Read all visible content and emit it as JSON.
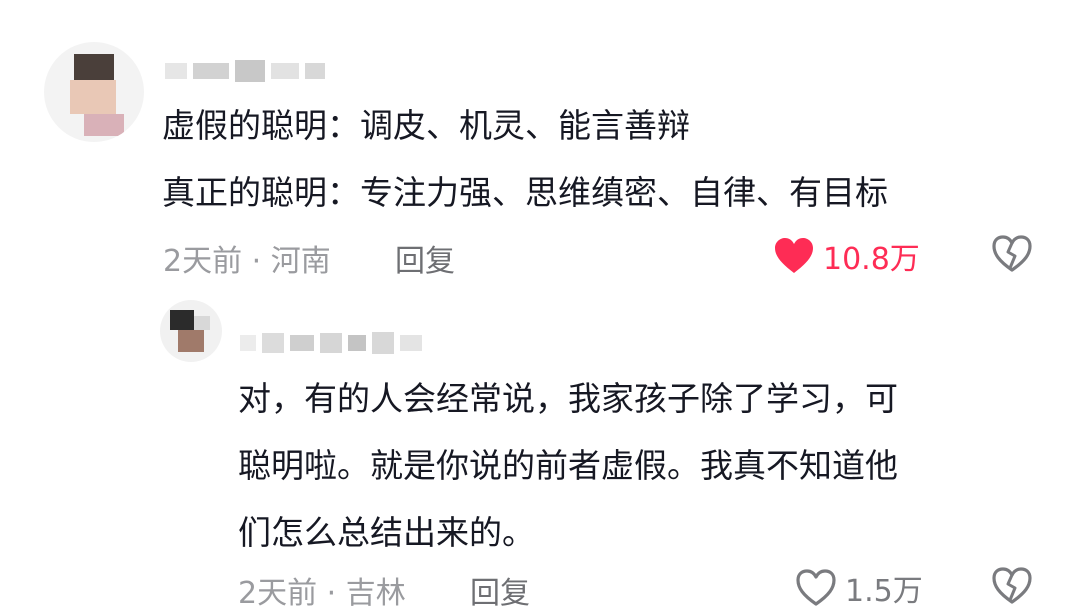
{
  "comment": {
    "text": "虚假的聪明：调皮、机灵、能言善辩\n真正的聪明：专注力强、思维缜密、自律、有目标",
    "time": "2天前",
    "location": "河南",
    "meta_separator": "·",
    "reply_label": "回复",
    "like_count": "10.8万",
    "liked": true,
    "like_color": "#fe2c55",
    "like_icon": "heart-filled-icon",
    "dislike_icon": "broken-heart-icon"
  },
  "reply": {
    "text": "对，有的人会经常说，我家孩子除了学习，可\n聪明啦。就是你说的前者虚假。我真不知道他\n们怎么总结出来的。",
    "time": "2天前",
    "location": "吉林",
    "meta_separator": "·",
    "reply_label": "回复",
    "like_count": "1.5万",
    "liked": false,
    "like_icon": "heart-outline-icon",
    "dislike_icon": "broken-heart-icon"
  }
}
